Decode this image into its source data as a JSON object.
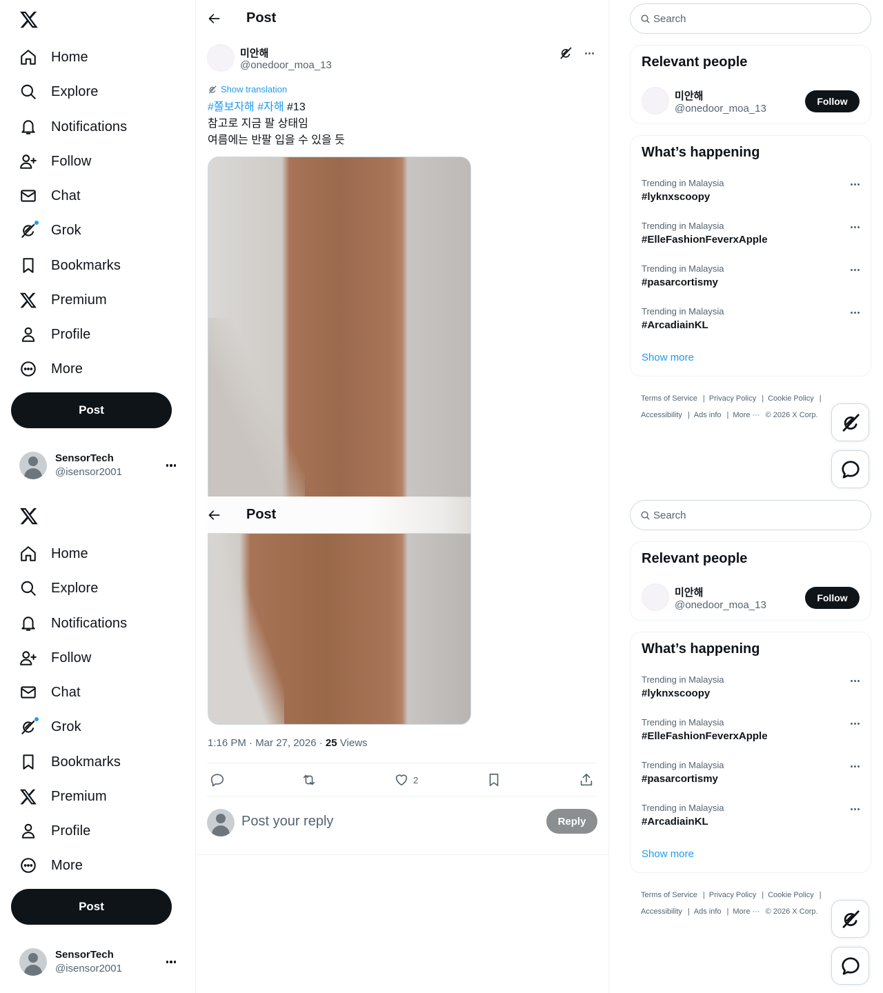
{
  "sidebar": {
    "items": [
      {
        "label": "Home"
      },
      {
        "label": "Explore"
      },
      {
        "label": "Notifications"
      },
      {
        "label": "Follow"
      },
      {
        "label": "Chat"
      },
      {
        "label": "Grok"
      },
      {
        "label": "Bookmarks"
      },
      {
        "label": "Premium"
      },
      {
        "label": "Profile"
      },
      {
        "label": "More"
      }
    ],
    "post_button": "Post",
    "account": {
      "name": "SensorTech",
      "handle": "@isensor2001"
    }
  },
  "header": {
    "title": "Post"
  },
  "tweet": {
    "author_name": "미안해",
    "author_handle": "@onedoor_moa_13",
    "show_translation": "Show translation",
    "hashtag_1": "#쫄보자해",
    "hashtag_2": "#자해",
    "tag_num": "#13",
    "line_2": "참고로 지금 팔 상태임",
    "line_3": "여름에는 반팔 입을 수 있을 듯",
    "timestamp": "1:16 PM · Mar 27, 2026 · ",
    "views_count": "25",
    "views_label": "Views",
    "likes": "2"
  },
  "reply": {
    "placeholder": "Post your reply",
    "button": "Reply"
  },
  "right": {
    "search_placeholder": "Search",
    "relevant_title": "Relevant people",
    "person": {
      "name": "미안해",
      "handle": "@onedoor_moa_13",
      "follow": "Follow"
    },
    "happening_title": "What’s happening",
    "trends": [
      {
        "context": "Trending in Malaysia",
        "name": "#lyknxscoopy"
      },
      {
        "context": "Trending in Malaysia",
        "name": "#ElleFashionFeverxApple"
      },
      {
        "context": "Trending in Malaysia",
        "name": "#pasarcortismy"
      },
      {
        "context": "Trending in Malaysia",
        "name": "#ArcadiainKL"
      }
    ],
    "show_more": "Show more",
    "footer": {
      "terms": "Terms of Service",
      "privacy": "Privacy Policy",
      "cookie": "Cookie Policy",
      "accessibility": "Accessibility",
      "ads": "Ads info",
      "more": "More ···",
      "copyright": "© 2026 X Corp."
    }
  },
  "icons": {
    "logo": "x-logo-icon",
    "nav": [
      "home-icon",
      "explore-icon",
      "notifications-icon",
      "follow-icon",
      "chat-icon",
      "grok-icon",
      "bookmarks-icon",
      "premium-icon",
      "profile-icon",
      "more-icon"
    ],
    "actions": [
      "reply-icon",
      "repost-icon",
      "like-icon",
      "bookmark-icon",
      "share-icon"
    ]
  },
  "colors": {
    "accent": "#1d9bf0",
    "text": "#0f1419",
    "muted": "#536471",
    "button": "#0f1419",
    "reply_button": "#8b8f92"
  }
}
